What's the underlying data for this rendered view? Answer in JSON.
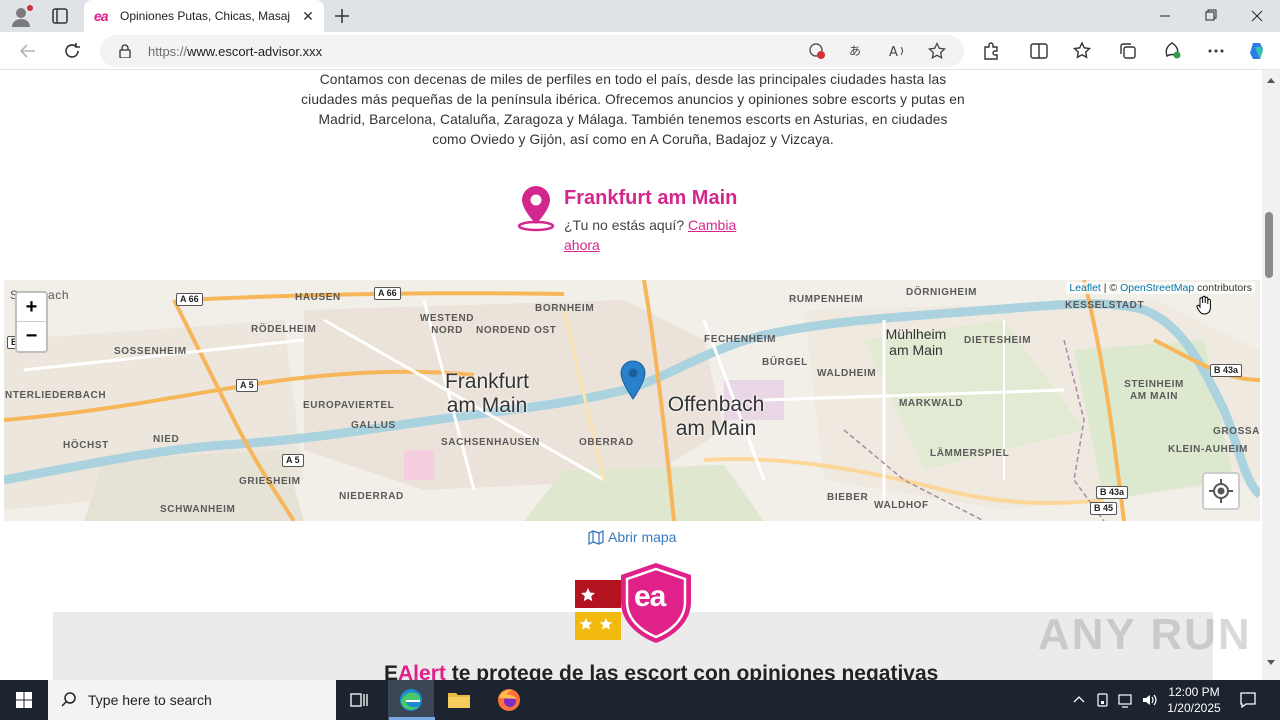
{
  "browser": {
    "tab_title": "Opiniones Putas, Chicas, Masajist",
    "tab_favicon_text": "ea",
    "url_prefix": "https://",
    "url_host": "www.escort-advisor.xxx"
  },
  "page": {
    "intro_text": "Contamos con decenas de miles de perfiles en todo el país, desde las principales ciudades hasta las ciudades más pequeñas de la península ibérica. Ofrecemos anuncios y opiniones sobre escorts y putas en Madrid, Barcelona, Cataluña, Zaragoza y Málaga. También tenemos escorts en Asturias, en ciudades como Oviedo y Gijón, así como en A Coruña, Badajoz y Vizcaya.",
    "location": {
      "city": "Frankfurt am Main",
      "not_here_text": "¿Tu no estás aquí?",
      "change_link": "Cambia ahora"
    },
    "map": {
      "zoom_in": "+",
      "zoom_out": "−",
      "attribution_leaflet": "Leaflet",
      "attribution_sep": " | © ",
      "attribution_osm": "OpenStreetMap",
      "attribution_suffix": " contributors",
      "labels": [
        "HAUSEN",
        "RÖDELHEIM",
        "WESTEND NORD",
        "NORDEND OST",
        "BORNHEIM",
        "FECHENHEIM",
        "RUMPENHEIM",
        "DÖRNIGHEIM",
        "KESSELSTADT",
        "SOSSENHEIM",
        "BÜRGEL",
        "WALDHEIM",
        "DIETESHEIM",
        "EUROPAVIERTEL",
        "GALLUS",
        "MARKWALD",
        "STEINHEIM AM MAIN",
        "NTERLIEDERBACH",
        "NIED",
        "SACHSENHAUSEN",
        "OBERRAD",
        "GROSSAU",
        "KLEIN-AUHEIM",
        "HÖCHST",
        "LÄMMERSPIEL",
        "GRIESHEIM",
        "NIEDERRAD",
        "SCHWANHEIM",
        "BIEBER",
        "WALDHOF"
      ],
      "big_labels": [
        "Frankfurt am Main",
        "Offenbach am Main"
      ],
      "mid_labels": [
        "Mühlheim am Main"
      ],
      "roads": [
        "A 66",
        "A 66",
        "A 5",
        "A 5",
        "B 43a",
        "B 43a",
        "B 45"
      ],
      "fragment_labels": [
        "S",
        "ach",
        "B"
      ]
    },
    "open_map_label": "Abrir mapa",
    "ealert_heading_prefix": "E",
    "ealert_heading_pink": "Alert",
    "ealert_heading_rest": " te protege de las escort con opiniones negativas",
    "logo_text": "ea",
    "watermark": "ANY RUN"
  },
  "taskbar": {
    "search_placeholder": "Type here to search",
    "time": "12:00 PM",
    "date": "1/20/2025"
  },
  "colors": {
    "brand_pink": "#d4278d",
    "map_bg": "#f2efe9",
    "link_blue": "#3a7bbf"
  }
}
